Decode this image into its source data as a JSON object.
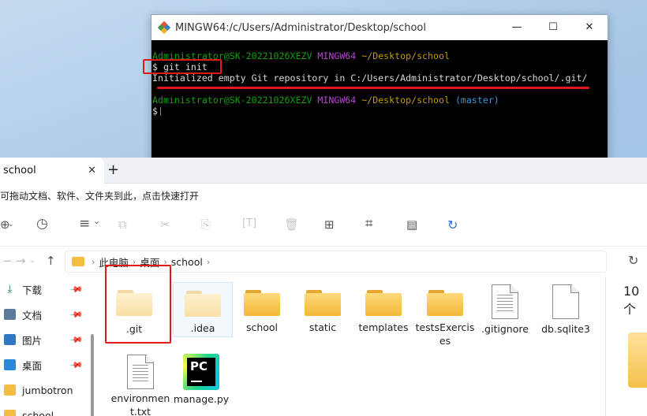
{
  "terminal": {
    "title": "MINGW64:/c/Users/Administrator/Desktop/school",
    "controls": [
      "—",
      "☐",
      "✕"
    ],
    "lines": [
      {
        "user": "Administrator@SK-20221026XEZV",
        "env": "MINGW64",
        "path": "~/Desktop/school",
        "branch": ""
      },
      {
        "text": "$ git init"
      },
      {
        "text": "Initialized empty Git repository in C:/Users/Administrator/Desktop/school/.git/"
      },
      {
        "user": "Administrator@SK-20221026XEZV",
        "env": "MINGW64",
        "path": "~/Desktop/school",
        "branch": "(master)"
      },
      {
        "text": "$"
      }
    ],
    "colors": {
      "user": "#13a10e",
      "env": "#b148c6",
      "path": "#c19c00",
      "branch": "#3a96dd",
      "highlight": "#e31818"
    }
  },
  "explorer": {
    "tab_title": "school",
    "tab_close": "✕",
    "tab_add": "+",
    "banner": "可拖动文档、软件、文件夹到此，点击快速打开",
    "toolbar": {
      "new": "⊕",
      "recent": "◷",
      "view": "≡",
      "view_arrow": "⌄"
    },
    "nav": {
      "forward": "→",
      "dropdown": "⌄",
      "up": "↑"
    },
    "breadcrumb": [
      "此电脑",
      "桌面",
      "school"
    ],
    "breadcrumb_sep": "›",
    "sidebar": [
      {
        "label": "下载",
        "icon": "download-icon",
        "pinned": true
      },
      {
        "label": "文档",
        "icon": "documents-icon",
        "pinned": true
      },
      {
        "label": "图片",
        "icon": "pictures-icon",
        "pinned": true
      },
      {
        "label": "桌面",
        "icon": "desktop-icon",
        "pinned": true
      },
      {
        "label": "jumbotron",
        "icon": "folder-icon",
        "pinned": false
      },
      {
        "label": "school",
        "icon": "folder-icon",
        "pinned": false
      }
    ],
    "pin_glyph": "📌",
    "files": [
      {
        "name": ".git",
        "type": "folder-light"
      },
      {
        "name": ".idea",
        "type": "folder-light"
      },
      {
        "name": "school",
        "type": "folder"
      },
      {
        "name": "static",
        "type": "folder"
      },
      {
        "name": "templates",
        "type": "folder"
      },
      {
        "name": "testsExercises",
        "type": "folder"
      },
      {
        "name": ".gitignore",
        "type": "document"
      },
      {
        "name": "db.sqlite3",
        "type": "document"
      },
      {
        "name": "environment.txt",
        "type": "document"
      },
      {
        "name": "manage.py",
        "type": "pycharm"
      }
    ],
    "pycharm_glyph": "PC",
    "details_count": "10 个"
  }
}
